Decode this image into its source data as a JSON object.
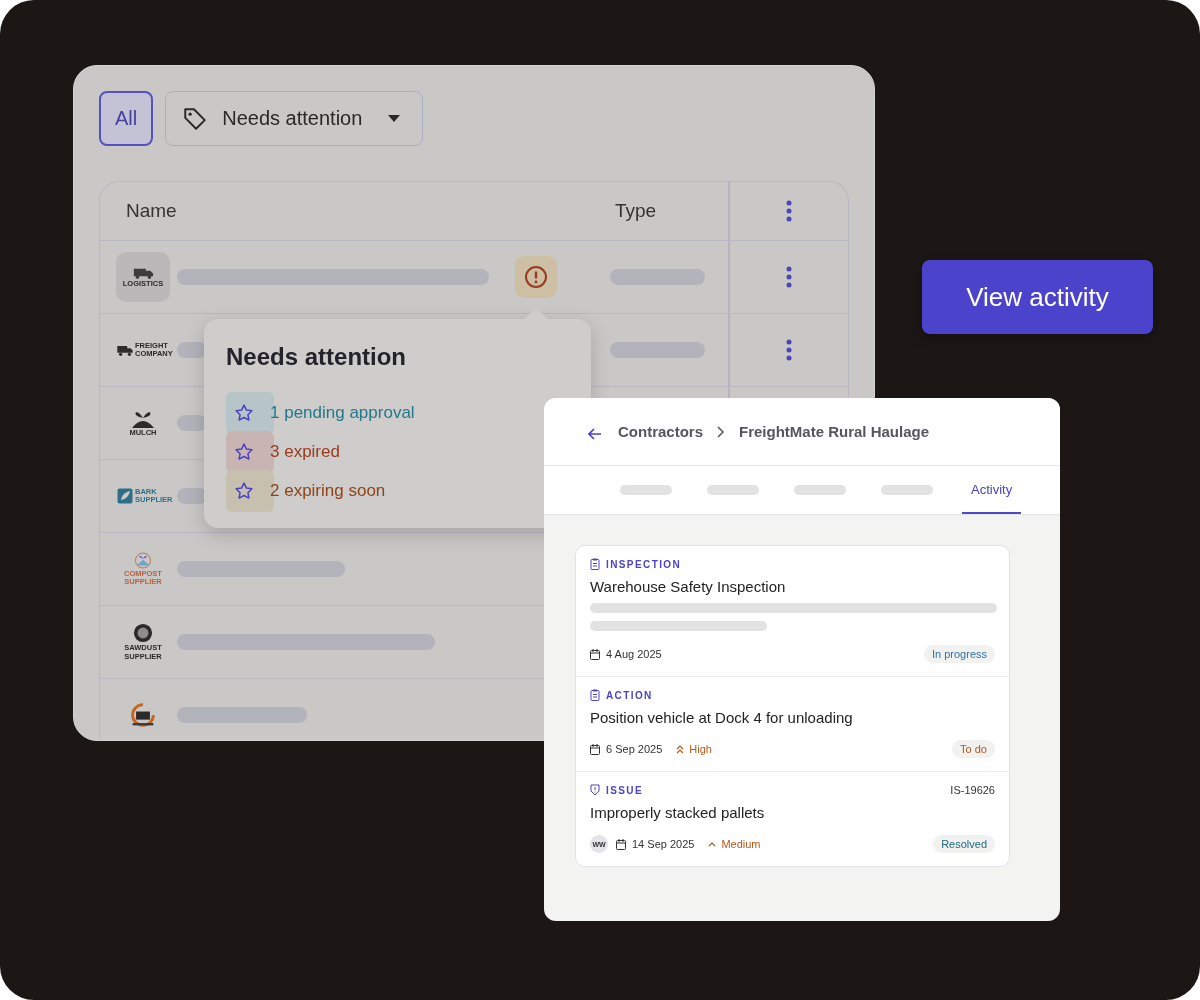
{
  "filters": [
    {
      "kind": "chip",
      "label": "All",
      "selected": true
    },
    {
      "kind": "dropdown",
      "label": "Needs attention",
      "selected": false
    }
  ],
  "table": {
    "columns": [
      "Name",
      "Type"
    ],
    "rows": [
      {
        "logo": {
          "kind": "truck",
          "words": "LOGISTICS",
          "tile": true
        },
        "alert": true,
        "menu": true
      },
      {
        "logo": {
          "kind": "truck_side",
          "words": "FREIGHT COMPANY"
        },
        "menu": true
      },
      {
        "logo": {
          "kind": "sprout",
          "words": "MULCH"
        }
      },
      {
        "logo": {
          "kind": "leaf",
          "words": "BARK SUPPLIER"
        }
      },
      {
        "logo": {
          "kind": "compost",
          "words": "COMPOST SUPPLIER"
        }
      },
      {
        "logo": {
          "kind": "saw",
          "words": "SAWDUST SUPPLIER"
        }
      },
      {
        "logo": {
          "kind": "ring"
        }
      }
    ]
  },
  "popover": {
    "title": "Needs attention",
    "items": [
      {
        "text": "1 pending approval",
        "color": "#23788c"
      },
      {
        "text": "3 expired",
        "color": "#9a3a1e"
      },
      {
        "text": "2 expiring soon",
        "color": "#8e4418"
      }
    ]
  },
  "cta": {
    "label": "View activity"
  },
  "detail": {
    "breadcrumb": [
      "Contractors",
      "FreightMate Rural Haulage"
    ],
    "tabs": [
      {
        "kind": "placeholder",
        "selected": false
      },
      {
        "kind": "placeholder",
        "selected": false
      },
      {
        "kind": "placeholder",
        "selected": false
      },
      {
        "kind": "placeholder",
        "selected": false
      },
      {
        "kind": "text",
        "label": "Activity",
        "selected": true
      }
    ],
    "activities": [
      {
        "kind": "clipboard",
        "category": "INSPECTION",
        "title": "Warehouse Safety Inspection",
        "description_hidden": true,
        "date": "4 Aug 2025",
        "status": {
          "label": "In progress",
          "color": "#2e74a8"
        }
      },
      {
        "kind": "clipboard",
        "category": "ACTION",
        "title": "Position vehicle at Dock 4 for unloading",
        "description_hidden": false,
        "date": "6 Sep 2025",
        "priority": {
          "kind": "high",
          "label": "High"
        },
        "status": {
          "label": "To do",
          "color": "#b4581c"
        }
      },
      {
        "kind": "shield",
        "category": "ISSUE",
        "reference": "IS-19626",
        "title": "Improperly stacked pallets",
        "description_hidden": false,
        "assignee": "WW",
        "date": "14 Sep 2025",
        "priority": {
          "kind": "medium",
          "label": "Medium"
        },
        "status": {
          "label": "Resolved",
          "color": "#1e6a7e"
        }
      }
    ]
  }
}
